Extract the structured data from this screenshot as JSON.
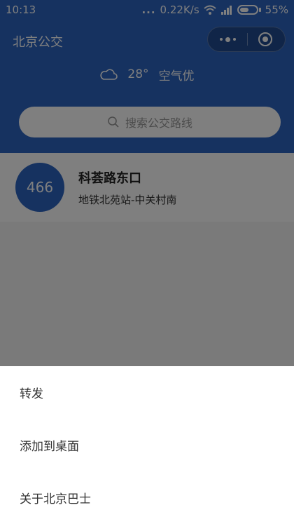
{
  "status_bar": {
    "time": "10:13",
    "dots": "...",
    "network_speed": "0.22K/s",
    "battery": "55%",
    "battery_level": 0.55
  },
  "header": {
    "title": "北京公交",
    "weather": {
      "icon": "cloud-icon",
      "temperature": "28°",
      "air_quality": "空气优"
    },
    "search": {
      "placeholder": "搜索公交路线"
    }
  },
  "route_card": {
    "route_number": "466",
    "stop_name": "科荟路东口",
    "route_line": "地铁北苑站-中关村南"
  },
  "action_sheet": {
    "items": [
      {
        "label": "转发"
      },
      {
        "label": "添加到桌面"
      },
      {
        "label": "关于北京巴士"
      }
    ]
  },
  "colors": {
    "brand_blue": "#2d64c0",
    "overlay": "rgba(0,0,0,0.5)"
  }
}
